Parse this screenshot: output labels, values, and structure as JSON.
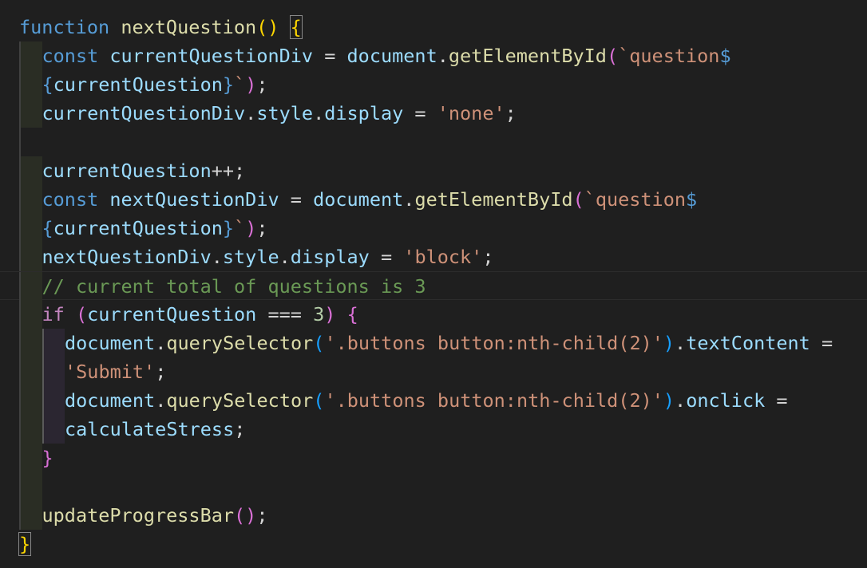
{
  "editor": {
    "language": "javascript",
    "theme": "dark",
    "current_line": 10,
    "lines": [
      {
        "indent": 0,
        "tokens": [
          {
            "t": "function",
            "c": "kw"
          },
          {
            "t": " ",
            "c": "op"
          },
          {
            "t": "nextQuestion",
            "c": "fn"
          },
          {
            "t": "()",
            "c": "b1"
          },
          {
            "t": " ",
            "c": "op"
          },
          {
            "t": "{",
            "c": "b1",
            "match": true
          }
        ]
      },
      {
        "indent": 1,
        "tokens": [
          {
            "t": "const",
            "c": "kw"
          },
          {
            "t": " ",
            "c": "op"
          },
          {
            "t": "currentQuestionDiv",
            "c": "var"
          },
          {
            "t": " = ",
            "c": "op"
          },
          {
            "t": "document",
            "c": "ident"
          },
          {
            "t": ".",
            "c": "pun"
          },
          {
            "t": "getElementById",
            "c": "fn"
          },
          {
            "t": "(",
            "c": "b2"
          },
          {
            "t": "`question",
            "c": "str"
          },
          {
            "t": "$",
            "c": "tpl"
          }
        ]
      },
      {
        "indent": 1,
        "tokens": [
          {
            "t": "{",
            "c": "tpl"
          },
          {
            "t": "currentQuestion",
            "c": "var"
          },
          {
            "t": "}",
            "c": "tpl"
          },
          {
            "t": "`",
            "c": "str"
          },
          {
            "t": ")",
            "c": "b2"
          },
          {
            "t": ";",
            "c": "pun"
          }
        ]
      },
      {
        "indent": 1,
        "tokens": [
          {
            "t": "currentQuestionDiv",
            "c": "var"
          },
          {
            "t": ".",
            "c": "pun"
          },
          {
            "t": "style",
            "c": "ident"
          },
          {
            "t": ".",
            "c": "pun"
          },
          {
            "t": "display",
            "c": "ident"
          },
          {
            "t": " = ",
            "c": "op"
          },
          {
            "t": "'none'",
            "c": "str"
          },
          {
            "t": ";",
            "c": "pun"
          }
        ]
      },
      {
        "indent": 1,
        "tokens": []
      },
      {
        "indent": 1,
        "tokens": [
          {
            "t": "currentQuestion",
            "c": "var"
          },
          {
            "t": "++",
            "c": "op"
          },
          {
            "t": ";",
            "c": "pun"
          }
        ]
      },
      {
        "indent": 1,
        "tokens": [
          {
            "t": "const",
            "c": "kw"
          },
          {
            "t": " ",
            "c": "op"
          },
          {
            "t": "nextQuestionDiv",
            "c": "var"
          },
          {
            "t": " = ",
            "c": "op"
          },
          {
            "t": "document",
            "c": "ident"
          },
          {
            "t": ".",
            "c": "pun"
          },
          {
            "t": "getElementById",
            "c": "fn"
          },
          {
            "t": "(",
            "c": "b2"
          },
          {
            "t": "`question",
            "c": "str"
          },
          {
            "t": "$",
            "c": "tpl"
          }
        ]
      },
      {
        "indent": 1,
        "tokens": [
          {
            "t": "{",
            "c": "tpl"
          },
          {
            "t": "currentQuestion",
            "c": "var"
          },
          {
            "t": "}",
            "c": "tpl"
          },
          {
            "t": "`",
            "c": "str"
          },
          {
            "t": ")",
            "c": "b2"
          },
          {
            "t": ";",
            "c": "pun"
          }
        ]
      },
      {
        "indent": 1,
        "tokens": [
          {
            "t": "nextQuestionDiv",
            "c": "var"
          },
          {
            "t": ".",
            "c": "pun"
          },
          {
            "t": "style",
            "c": "ident"
          },
          {
            "t": ".",
            "c": "pun"
          },
          {
            "t": "display",
            "c": "ident"
          },
          {
            "t": " = ",
            "c": "op"
          },
          {
            "t": "'block'",
            "c": "str"
          },
          {
            "t": ";",
            "c": "pun"
          }
        ]
      },
      {
        "indent": 1,
        "tokens": [
          {
            "t": "// current total of questions is 3",
            "c": "cmt"
          }
        ]
      },
      {
        "indent": 1,
        "tokens": [
          {
            "t": "if",
            "c": "ctl"
          },
          {
            "t": " ",
            "c": "op"
          },
          {
            "t": "(",
            "c": "b2"
          },
          {
            "t": "currentQuestion",
            "c": "var"
          },
          {
            "t": " === ",
            "c": "op"
          },
          {
            "t": "3",
            "c": "num"
          },
          {
            "t": ")",
            "c": "b2"
          },
          {
            "t": " ",
            "c": "op"
          },
          {
            "t": "{",
            "c": "b2"
          }
        ]
      },
      {
        "indent": 2,
        "tokens": [
          {
            "t": "document",
            "c": "ident"
          },
          {
            "t": ".",
            "c": "pun"
          },
          {
            "t": "querySelector",
            "c": "fn"
          },
          {
            "t": "(",
            "c": "b3"
          },
          {
            "t": "'.buttons button:nth-child(2)'",
            "c": "str"
          },
          {
            "t": ")",
            "c": "b3"
          },
          {
            "t": ".",
            "c": "pun"
          },
          {
            "t": "textContent",
            "c": "ident"
          },
          {
            "t": " =",
            "c": "op"
          }
        ]
      },
      {
        "indent": 2,
        "tokens": [
          {
            "t": "'Submit'",
            "c": "str"
          },
          {
            "t": ";",
            "c": "pun"
          }
        ]
      },
      {
        "indent": 2,
        "tokens": [
          {
            "t": "document",
            "c": "ident"
          },
          {
            "t": ".",
            "c": "pun"
          },
          {
            "t": "querySelector",
            "c": "fn"
          },
          {
            "t": "(",
            "c": "b3"
          },
          {
            "t": "'.buttons button:nth-child(2)'",
            "c": "str"
          },
          {
            "t": ")",
            "c": "b3"
          },
          {
            "t": ".",
            "c": "pun"
          },
          {
            "t": "onclick",
            "c": "ident"
          },
          {
            "t": " =",
            "c": "op"
          }
        ]
      },
      {
        "indent": 2,
        "tokens": [
          {
            "t": "calculateStress",
            "c": "ident"
          },
          {
            "t": ";",
            "c": "pun"
          }
        ]
      },
      {
        "indent": 1,
        "tokens": [
          {
            "t": "}",
            "c": "b2"
          }
        ]
      },
      {
        "indent": 1,
        "tokens": []
      },
      {
        "indent": 1,
        "tokens": [
          {
            "t": "updateProgressBar",
            "c": "fn"
          },
          {
            "t": "()",
            "c": "b2"
          },
          {
            "t": ";",
            "c": "pun"
          }
        ]
      },
      {
        "indent": 0,
        "tokens": [
          {
            "t": "}",
            "c": "b1",
            "match": true
          }
        ]
      }
    ]
  }
}
